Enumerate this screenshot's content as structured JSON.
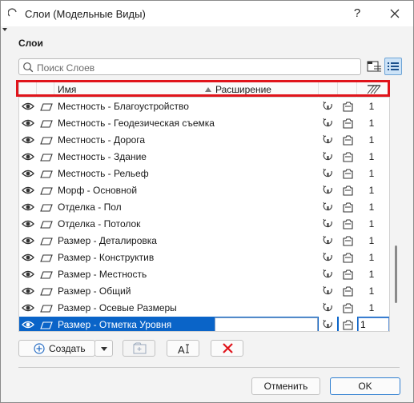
{
  "window": {
    "title": "Слои (Модельные Виды)",
    "help_label": "?",
    "close_label": "✕"
  },
  "section": {
    "label": "Слои"
  },
  "search": {
    "placeholder": "Поиск Слоев"
  },
  "table": {
    "headers": {
      "name": "Имя",
      "extension": "Расширение"
    },
    "rows": [
      {
        "name": "Местность - Благоустройство",
        "extension": "",
        "pen": "1",
        "selected": false
      },
      {
        "name": "Местность - Геодезическая съемка",
        "extension": "",
        "pen": "1",
        "selected": false
      },
      {
        "name": "Местность - Дорога",
        "extension": "",
        "pen": "1",
        "selected": false
      },
      {
        "name": "Местность - Здание",
        "extension": "",
        "pen": "1",
        "selected": false
      },
      {
        "name": "Местность - Рельеф",
        "extension": "",
        "pen": "1",
        "selected": false
      },
      {
        "name": "Морф - Основной",
        "extension": "",
        "pen": "1",
        "selected": false
      },
      {
        "name": "Отделка - Пол",
        "extension": "",
        "pen": "1",
        "selected": false
      },
      {
        "name": "Отделка - Потолок",
        "extension": "",
        "pen": "1",
        "selected": false
      },
      {
        "name": "Размер - Деталировка",
        "extension": "",
        "pen": "1",
        "selected": false
      },
      {
        "name": "Размер - Конструктив",
        "extension": "",
        "pen": "1",
        "selected": false
      },
      {
        "name": "Размер - Местность",
        "extension": "",
        "pen": "1",
        "selected": false
      },
      {
        "name": "Размер - Общий",
        "extension": "",
        "pen": "1",
        "selected": false
      },
      {
        "name": "Размер - Осевые Размеры",
        "extension": "",
        "pen": "1",
        "selected": false
      },
      {
        "name": "Размер - Отметка Уровня",
        "extension": "",
        "pen": "1",
        "selected": true
      }
    ]
  },
  "toolbar": {
    "create_label": "Создать"
  },
  "footer": {
    "cancel_label": "Отменить",
    "ok_label": "OK"
  },
  "colors": {
    "selection": "#0a64c8",
    "highlight_box": "#e0141b",
    "delete_icon": "#e0141b",
    "create_icon": "#2a6fc4"
  },
  "icons": [
    "app-icon",
    "help-icon",
    "close-icon",
    "search-icon",
    "tree-view-icon",
    "list-view-icon",
    "eye-icon",
    "lock-icon",
    "pen-column-icon",
    "layer-intersection-icon",
    "wireframe-icon",
    "add-icon",
    "dropdown-arrow-icon",
    "new-folder-icon",
    "rename-icon",
    "delete-icon"
  ]
}
